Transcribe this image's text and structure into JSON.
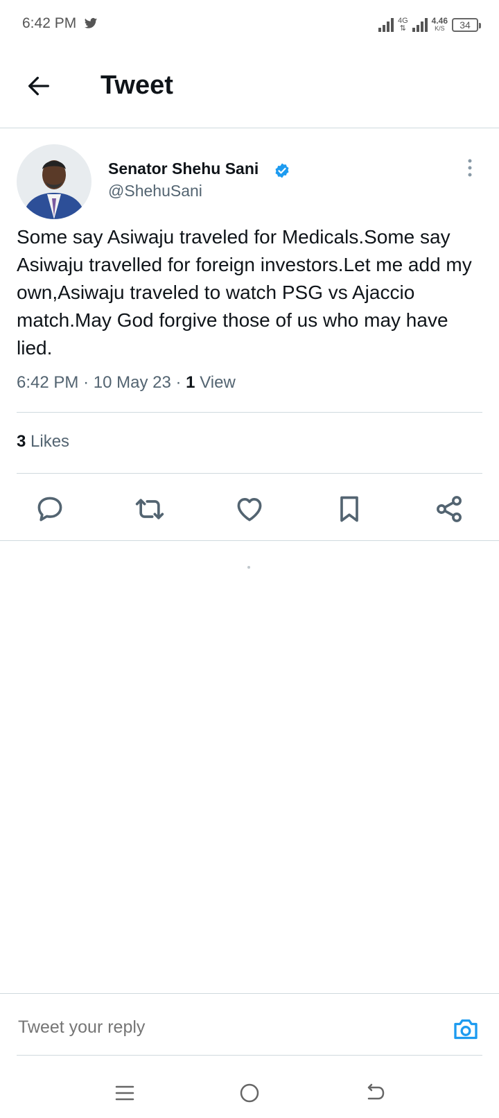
{
  "status_bar": {
    "time": "6:42 PM",
    "network_label": "4G",
    "network_sub": "⇅",
    "speed_value": "4.46",
    "speed_unit": "K/S",
    "battery": "34"
  },
  "header": {
    "title": "Tweet"
  },
  "tweet": {
    "author_name": "Senator Shehu Sani",
    "author_handle": "@ShehuSani",
    "text": "Some say Asiwaju traveled for Medicals.Some say Asiwaju travelled for foreign investors.Let me add my own,Asiwaju traveled to watch PSG vs Ajaccio match.May God forgive those of us who may have lied.",
    "time": "6:42 PM",
    "date": "10 May 23",
    "separator": "·",
    "view_count": "1",
    "view_label": "View",
    "like_count": "3",
    "like_label": "Likes"
  },
  "reply": {
    "placeholder": "Tweet your reply"
  },
  "colors": {
    "accent": "#1d9bf0",
    "text": "#0f1419",
    "muted": "#536471"
  }
}
